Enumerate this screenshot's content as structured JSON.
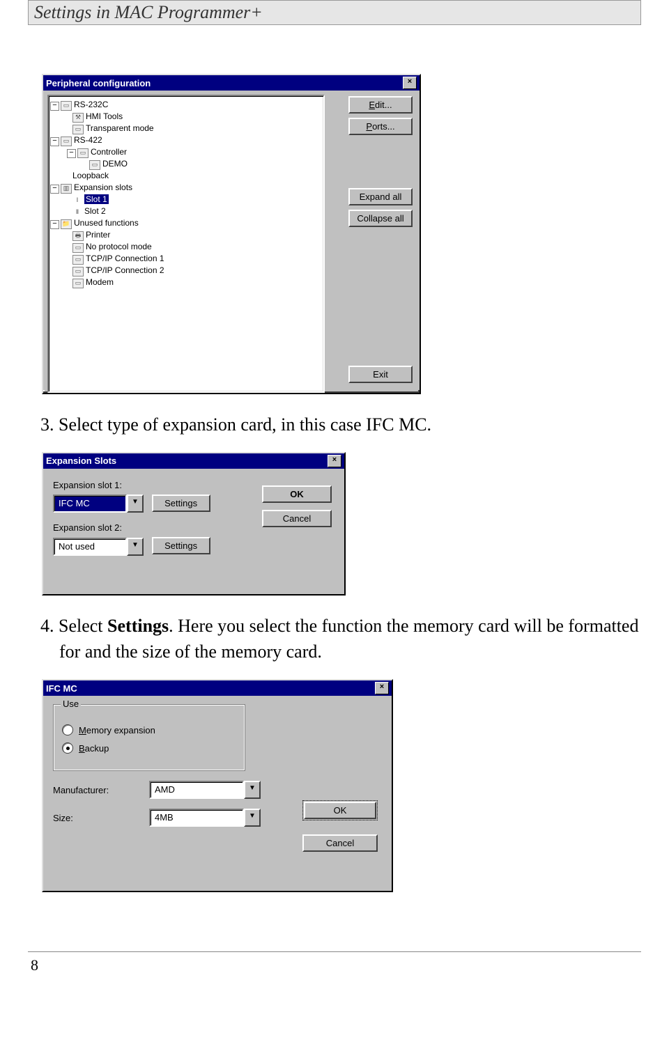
{
  "header": {
    "title": "Settings in MAC Programmer+"
  },
  "step3": {
    "num": "3.",
    "text": "Select type of expansion card, in this case IFC MC."
  },
  "step4": {
    "num": "4.",
    "pre": "Select ",
    "bold": "Settings",
    "post": ". Here you select the function the memory card will be formatted for and the size of the memory card."
  },
  "dialog1": {
    "title": "Peripheral configuration",
    "close": "×",
    "tree": {
      "rs232c": "RS-232C",
      "hmi": "HMI Tools",
      "transparent": "Transparent mode",
      "rs422": "RS-422",
      "controller": "Controller",
      "demo": "DEMO",
      "loopback": "Loopback",
      "expslots": "Expansion slots",
      "slot1": "Slot 1",
      "slot2": "Slot 2",
      "unused": "Unused functions",
      "printer": "Printer",
      "noproto": "No protocol mode",
      "tcp1": "TCP/IP Connection 1",
      "tcp2": "TCP/IP Connection 2",
      "modem": "Modem"
    },
    "buttons": {
      "edit": "Edit...",
      "ports": "Ports...",
      "expand": "Expand all",
      "collapse": "Collapse all",
      "exit": "Exit"
    }
  },
  "dialog2": {
    "title": "Expansion Slots",
    "close": "×",
    "slot1_label": "Expansion slot 1:",
    "slot1_value": "IFC MC",
    "slot2_label": "Expansion slot 2:",
    "slot2_value": "Not used",
    "settings": "Settings",
    "ok": "OK",
    "cancel": "Cancel"
  },
  "dialog3": {
    "title": "IFC MC",
    "close": "×",
    "group": "Use",
    "memexp": "Memory expansion",
    "backup": "Backup",
    "manuf_label": "Manufacturer:",
    "manuf_value": "AMD",
    "size_label": "Size:",
    "size_value": "4MB",
    "ok": "OK",
    "cancel": "Cancel"
  },
  "footer": {
    "page": "8"
  }
}
